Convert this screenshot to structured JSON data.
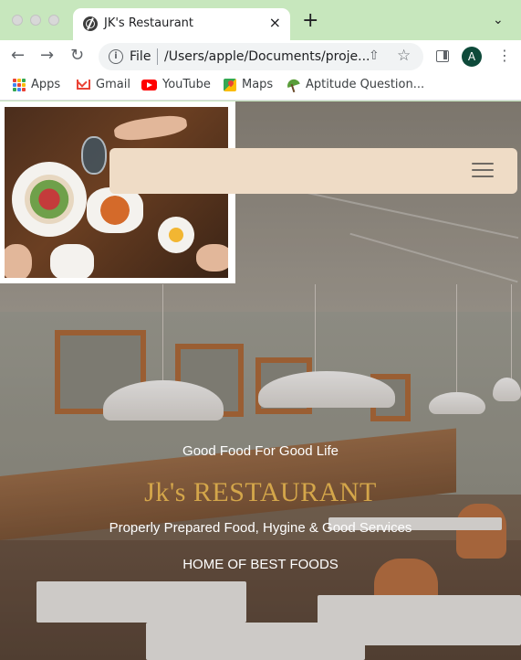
{
  "browser": {
    "tab": {
      "title": "JK's Restaurant",
      "close_glyph": "×"
    },
    "new_tab_glyph": "+",
    "tab_dropdown_glyph": "⌄",
    "nav": {
      "back_glyph": "←",
      "forward_glyph": "→",
      "reload_glyph": "↻"
    },
    "omnibox": {
      "scheme": "File",
      "path": "/Users/apple/Documents/proje...",
      "info_glyph": "i"
    },
    "share_glyph": "⇧",
    "star_glyph": "☆",
    "avatar_letter": "A",
    "menu_glyph": "⋮",
    "bookmarks": [
      {
        "label": "Apps",
        "icon": "apps-grid-icon"
      },
      {
        "label": "Gmail",
        "icon": "gmail-icon"
      },
      {
        "label": "YouTube",
        "icon": "youtube-icon"
      },
      {
        "label": "Maps",
        "icon": "maps-icon"
      },
      {
        "label": "Aptitude Question...",
        "icon": "aptitude-icon"
      }
    ]
  },
  "page": {
    "hero": {
      "tagline": "Good Food For Good Life",
      "brand": "Jk's RESTAURANT",
      "subtitle": "Properly Prepared Food, Hygine & Good Services",
      "cta": "HOME OF BEST FOODS"
    },
    "colors": {
      "navbar_bg": "#efdcc6",
      "brand_text": "#d4a64a",
      "tab_strip": "#c7e7bd"
    }
  }
}
